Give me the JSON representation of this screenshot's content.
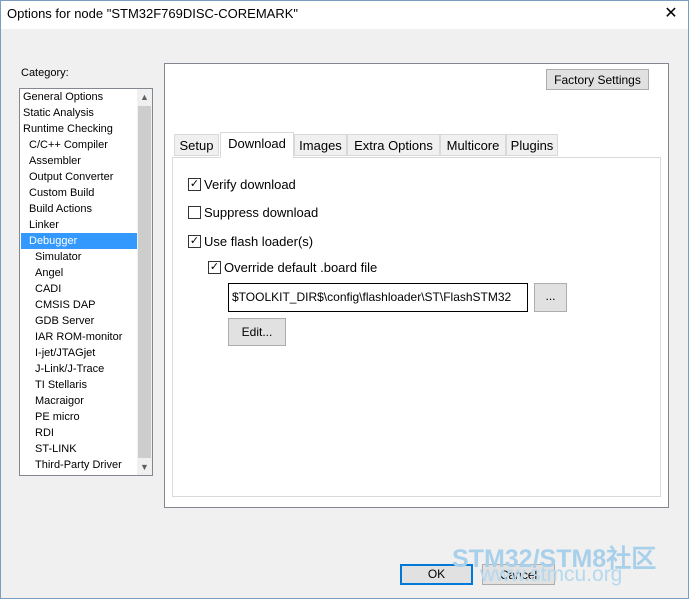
{
  "window": {
    "title": "Options for node \"STM32F769DISC-COREMARK\"",
    "close_glyph": "✕"
  },
  "category": {
    "label": "Category:",
    "items": [
      "General Options",
      "Static Analysis",
      "Runtime Checking",
      "C/C++ Compiler",
      "Assembler",
      "Output Converter",
      "Custom Build",
      "Build Actions",
      "Linker",
      "Debugger",
      "Simulator",
      "Angel",
      "CADI",
      "CMSIS DAP",
      "GDB Server",
      "IAR ROM-monitor",
      "I-jet/JTAGjet",
      "J-Link/J-Trace",
      "TI Stellaris",
      "Macraigor",
      "PE micro",
      "RDI",
      "ST-LINK",
      "Third-Party Driver"
    ],
    "selected": "Debugger",
    "scroll_up": "▲",
    "scroll_down": "▼"
  },
  "factory_settings_label": "Factory Settings",
  "tabs": [
    "Setup",
    "Download",
    "Images",
    "Extra Options",
    "Multicore",
    "Plugins"
  ],
  "active_tab": "Download",
  "download": {
    "verify_download": {
      "label": "Verify download",
      "checked": true
    },
    "suppress_download": {
      "label": "Suppress download",
      "checked": false
    },
    "use_flash_loader": {
      "label": "Use flash loader(s)",
      "checked": true
    },
    "override_board_file": {
      "label": "Override default .board file",
      "checked": true
    },
    "board_file_path": "$TOOLKIT_DIR$\\config\\flashloader\\ST\\FlashSTM32",
    "browse_label": "...",
    "edit_label": "Edit..."
  },
  "buttons": {
    "ok": "OK",
    "cancel": "Cancel"
  },
  "watermark": {
    "line1": "STM32/STM8社区",
    "line2": "www.stmcu.org"
  }
}
